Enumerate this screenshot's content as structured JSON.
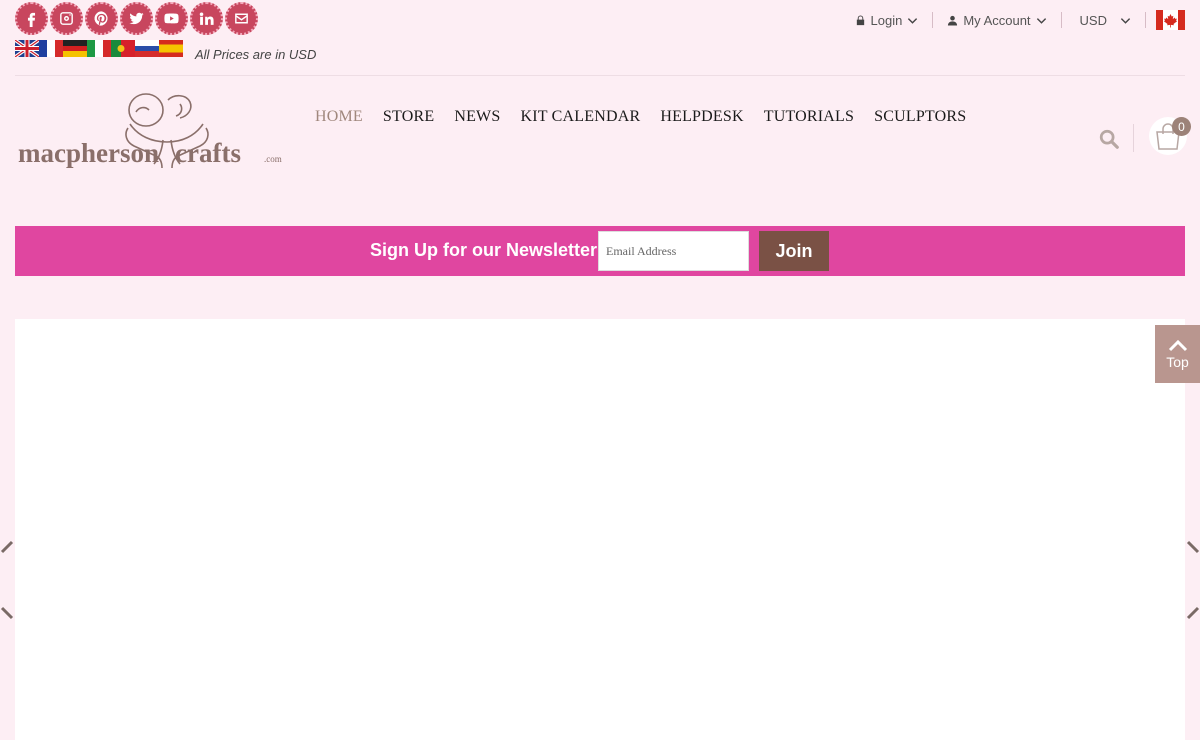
{
  "social": [
    {
      "icon": "facebook-icon"
    },
    {
      "icon": "instagram-icon"
    },
    {
      "icon": "pinterest-icon"
    },
    {
      "icon": "twitter-icon"
    },
    {
      "icon": "youtube-icon"
    },
    {
      "icon": "linkedin-icon"
    },
    {
      "icon": "email-icon"
    }
  ],
  "languages": [
    "English",
    "French",
    "German",
    "Italian",
    "Portuguese",
    "Russian",
    "Spanish"
  ],
  "prices_note": "All Prices are in USD",
  "topbar": {
    "login": "Login",
    "account": "My Account",
    "currency": "USD"
  },
  "nav": {
    "home": "HOME",
    "store": "STORE",
    "news": "NEWS",
    "kit_calendar": "KIT CALENDAR",
    "helpdesk": "HELPDESK",
    "tutorials": "TUTORIALS",
    "sculptors": "SCULPTORS"
  },
  "logo": {
    "text_left": "macpherson",
    "text_right": "crafts",
    "suffix": ".com"
  },
  "cart": {
    "count": "0"
  },
  "newsletter": {
    "label": "Sign Up for our Newsletter",
    "placeholder": "Email Address",
    "button": "Join"
  },
  "back_to_top": "Top",
  "colors": {
    "page_bg": "#fdeef4",
    "newsletter_bg": "#e046a0",
    "join_button": "#7a5145",
    "social_bg": "#c8465e",
    "active_nav": "#a0877d",
    "top_button": "#b9968f"
  }
}
